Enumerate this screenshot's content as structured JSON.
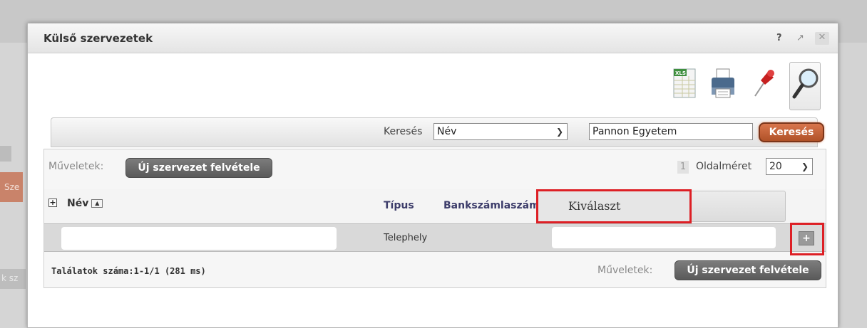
{
  "background": {
    "left_chip_text": "Sze",
    "left_chip_text2": "k sz"
  },
  "dialog": {
    "title": "Külső szervezetek",
    "help_label": "?",
    "restore_label": "↗",
    "close_label": "✕"
  },
  "toolbar": {
    "icons": [
      "excel-export-icon",
      "print-icon",
      "pin-icon",
      "search-magnifier-icon"
    ]
  },
  "search": {
    "label": "Keresés",
    "field_selected": "Név",
    "query_value": "Pannon Egyetem",
    "button_label": "Keresés"
  },
  "operations": {
    "label": "Műveletek:",
    "new_button_label": "Új szervezet felvétele",
    "page_number": "1",
    "page_size_label": "Oldalméret",
    "page_size_value": "20"
  },
  "table": {
    "expand_symbol": "+",
    "columns": {
      "name": "Név",
      "type": "Típus",
      "bank": "Bankszámlaszám"
    },
    "select_label": "Kiválaszt",
    "rows": [
      {
        "type": "Telephely",
        "select_symbol": "+"
      }
    ]
  },
  "footer": {
    "results": "Találatok száma:1-1/1 (281 ms)",
    "operations_label": "Műveletek:",
    "new_button_label": "Új szervezet felvétele"
  },
  "colors": {
    "search_button": "#c0633a",
    "highlight": "#dd1f25"
  }
}
